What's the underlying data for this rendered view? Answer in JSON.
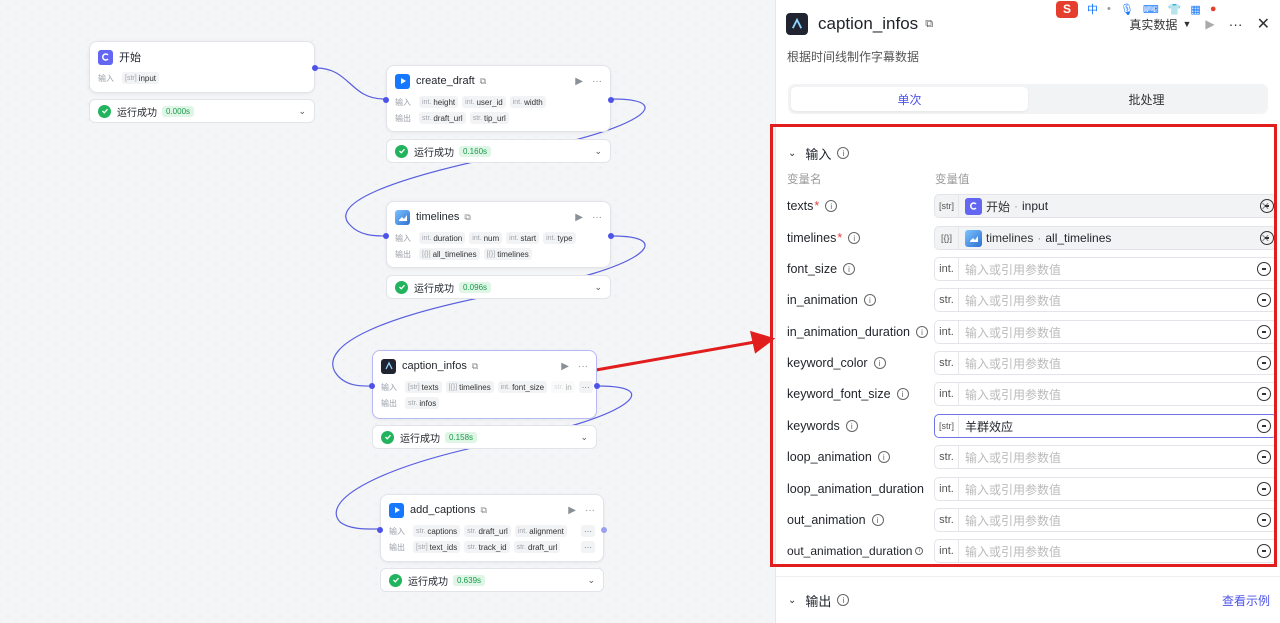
{
  "canvas": {
    "nodes": {
      "start": {
        "title": "开始",
        "input_label": "输入",
        "inputs": [
          {
            "type": "[str]",
            "name": "input"
          }
        ],
        "status": "运行成功",
        "time": "0.000s"
      },
      "create_draft": {
        "title": "create_draft",
        "input_label": "输入",
        "output_label": "输出",
        "inputs": [
          {
            "type": "int.",
            "name": "height"
          },
          {
            "type": "int.",
            "name": "user_id"
          },
          {
            "type": "int.",
            "name": "width"
          }
        ],
        "outputs": [
          {
            "type": "str.",
            "name": "draft_url"
          },
          {
            "type": "str.",
            "name": "tip_url"
          }
        ],
        "status": "运行成功",
        "time": "0.160s"
      },
      "timelines": {
        "title": "timelines",
        "input_label": "输入",
        "output_label": "输出",
        "inputs": [
          {
            "type": "int.",
            "name": "duration"
          },
          {
            "type": "int.",
            "name": "num"
          },
          {
            "type": "int.",
            "name": "start"
          },
          {
            "type": "int.",
            "name": "type"
          }
        ],
        "outputs": [
          {
            "type": "[{}]",
            "name": "all_timelines"
          },
          {
            "type": "[{}]",
            "name": "timelines"
          }
        ],
        "status": "运行成功",
        "time": "0.096s"
      },
      "caption_infos": {
        "title": "caption_infos",
        "input_label": "输入",
        "output_label": "输出",
        "inputs": [
          {
            "type": "[str]",
            "name": "texts"
          },
          {
            "type": "[{}]",
            "name": "timelines"
          },
          {
            "type": "int.",
            "name": "font_size"
          },
          {
            "type": "str.",
            "name": "in"
          }
        ],
        "outputs": [
          {
            "type": "str.",
            "name": "infos"
          }
        ],
        "more": "···",
        "status": "运行成功",
        "time": "0.158s"
      },
      "add_captions": {
        "title": "add_captions",
        "input_label": "输入",
        "output_label": "输出",
        "inputs": [
          {
            "type": "str.",
            "name": "captions"
          },
          {
            "type": "str.",
            "name": "draft_url"
          },
          {
            "type": "int.",
            "name": "alignment"
          }
        ],
        "outputs": [
          {
            "type": "[str]",
            "name": "text_ids"
          },
          {
            "type": "str.",
            "name": "track_id"
          },
          {
            "type": "str.",
            "name": "draft_url"
          }
        ],
        "more": "···",
        "status": "运行成功",
        "time": "0.639s"
      }
    }
  },
  "panel": {
    "title": "caption_infos",
    "description": "根据时间线制作字幕数据",
    "mode_label": "真实数据",
    "tabs": [
      "单次",
      "批处理"
    ],
    "input_section": {
      "title": "输入",
      "col_name": "变量名",
      "col_value": "变量值",
      "params": [
        {
          "name": "texts",
          "required": true,
          "type": "[str]",
          "ref_node": "开始",
          "ref_var": "input"
        },
        {
          "name": "timelines",
          "required": true,
          "type": "[{}]",
          "ref_node": "timelines",
          "ref_var": "all_timelines"
        },
        {
          "name": "font_size",
          "type": "int.",
          "placeholder": "输入或引用参数值"
        },
        {
          "name": "in_animation",
          "type": "str.",
          "placeholder": "输入或引用参数值"
        },
        {
          "name": "in_animation_duration",
          "type": "int.",
          "placeholder": "输入或引用参数值"
        },
        {
          "name": "keyword_color",
          "type": "str.",
          "placeholder": "输入或引用参数值"
        },
        {
          "name": "keyword_font_size",
          "type": "int.",
          "placeholder": "输入或引用参数值"
        },
        {
          "name": "keywords",
          "type": "[str]",
          "value": "羊群效应"
        },
        {
          "name": "loop_animation",
          "type": "str.",
          "placeholder": "输入或引用参数值"
        },
        {
          "name": "loop_animation_duration",
          "type": "int.",
          "placeholder": "输入或引用参数值"
        },
        {
          "name": "out_animation",
          "type": "str.",
          "placeholder": "输入或引用参数值"
        },
        {
          "name": "out_animation_duration",
          "type": "int.",
          "placeholder": "输入或引用参数值"
        }
      ]
    },
    "output_section": {
      "title": "输出",
      "link": "查看示例"
    }
  },
  "tray": {
    "ime": "S",
    "lang": "中"
  },
  "colors": {
    "accent": "#4d53e8",
    "success": "#22b35e",
    "highlight": "#e11d1d"
  }
}
